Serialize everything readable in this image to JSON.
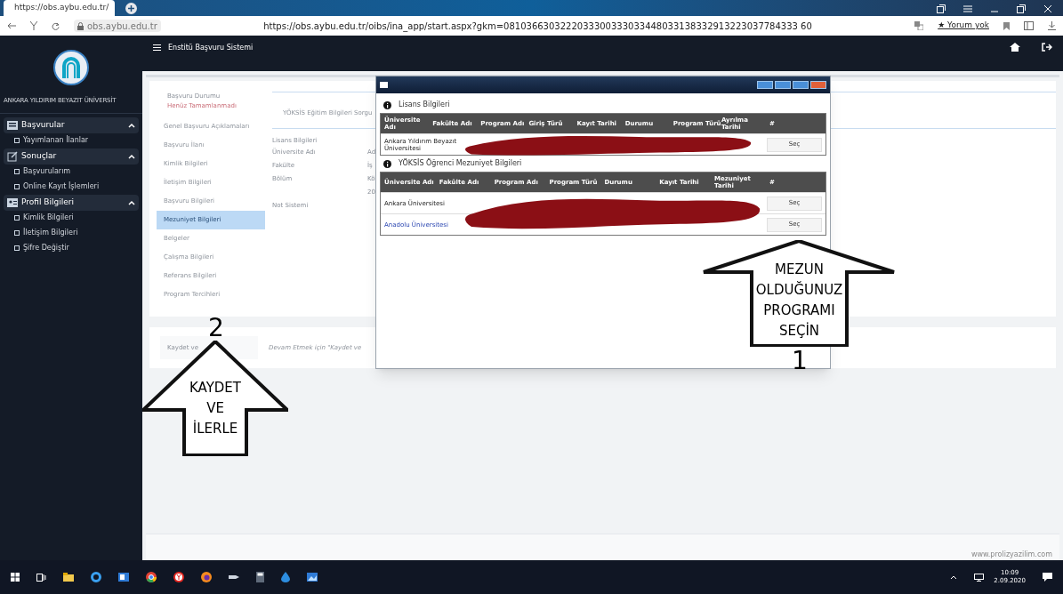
{
  "browser": {
    "tab_title": "https://obs.aybu.edu.tr/",
    "domain": "obs.aybu.edu.tr",
    "url": "https://obs.aybu.edu.tr/oibs/ina_app/start.aspx?gkm=0810366303222033300333033448033138332913223037784333 60",
    "comments": "★ Yorum yok"
  },
  "sidebar": {
    "university": "ANKARA YILDIRIM BEYAZIT ÜNİVERSİT",
    "groups": [
      {
        "label": "Başvurular",
        "kind": "list",
        "expanded": true,
        "items": [
          "Yayımlanan İlanlar"
        ]
      },
      {
        "label": "Sonuçlar",
        "kind": "edit",
        "expanded": true,
        "items": [
          "Başvurularım",
          "Online Kayıt İşlemleri"
        ]
      },
      {
        "label": "Profil Bilgileri",
        "kind": "card",
        "expanded": true,
        "items": [
          "Kimlik Bilgileri",
          "İletişim Bilgileri",
          "Şifre Değiştir"
        ]
      }
    ]
  },
  "header": {
    "title": "Enstitü Başvuru Sistemi"
  },
  "status": {
    "label": "Başvuru Durumu",
    "value": "Henüz Tamamlanmadı"
  },
  "steps": [
    {
      "label": "Genel Başvuru Açıklamaları",
      "selected": false
    },
    {
      "label": "Başvuru İlanı",
      "selected": false
    },
    {
      "label": "Kimlik Bilgileri",
      "selected": false
    },
    {
      "label": "İletişim Bilgileri",
      "selected": false
    },
    {
      "label": "Başvuru Bilgileri",
      "selected": false
    },
    {
      "label": "Mezuniyet Bilgileri",
      "selected": true
    },
    {
      "label": "Belgeler",
      "selected": false
    },
    {
      "label": "Çalışma Bilgileri",
      "selected": false
    },
    {
      "label": "Referans Bilgileri",
      "selected": false
    },
    {
      "label": "Program Tercihleri",
      "selected": false
    }
  ],
  "form": {
    "title": "YÖKSİS Eğitim Bilgileri Sorgu",
    "section": "Lisans Bilgileri",
    "rows": [
      {
        "label": "Üniversite Adı",
        "value": "Ad"
      },
      {
        "label": "Fakülte",
        "value": "İş"
      },
      {
        "label": "Bölüm",
        "value": "Kö"
      },
      {
        "label": "",
        "value": "20"
      },
      {
        "label": "Not Sistemi",
        "value": ""
      }
    ]
  },
  "save": {
    "button": "Kaydet ve",
    "hint": "Devam Etmek için \"Kaydet ve"
  },
  "modal": {
    "sections": [
      {
        "title": "Lisans Bilgileri",
        "columns": [
          "Üniversite Adı",
          "Fakülte Adı",
          "Program Adı",
          "Giriş Türü",
          "Kayıt Tarihi",
          "Durumu",
          "Program Türü",
          "Ayrılma Tarihi",
          "#"
        ],
        "rows": [
          {
            "university": "Ankara Yıldırım Beyazıt Üniversitesi",
            "link": false,
            "action": "Seç"
          }
        ]
      },
      {
        "title": "YÖKSİS Öğrenci Mezuniyet Bilgileri",
        "columns": [
          "Üniversite Adı",
          "Fakülte Adı",
          "Program Adı",
          "Program Türü",
          "Durumu",
          "Kayıt Tarihi",
          "Mezuniyet Tarihi",
          "#"
        ],
        "rows": [
          {
            "university": "Ankara Üniversitesi",
            "link": false,
            "action": "Seç"
          },
          {
            "university": "Anadolu Üniversitesi",
            "link": true,
            "action": "Seç"
          }
        ]
      }
    ]
  },
  "annotations": [
    {
      "lines": [
        "MEZUN",
        "OLDUĞUNUZ",
        "PROGRAMI",
        "SEÇİN"
      ],
      "number": "1"
    },
    {
      "lines": [
        "KAYDET",
        "VE",
        "İLERLE"
      ],
      "number": "2"
    }
  ],
  "footer": {
    "credit": "www.prolizyazilim.com"
  },
  "taskbar": {
    "time": "10:09",
    "date": "2.09.2020"
  }
}
